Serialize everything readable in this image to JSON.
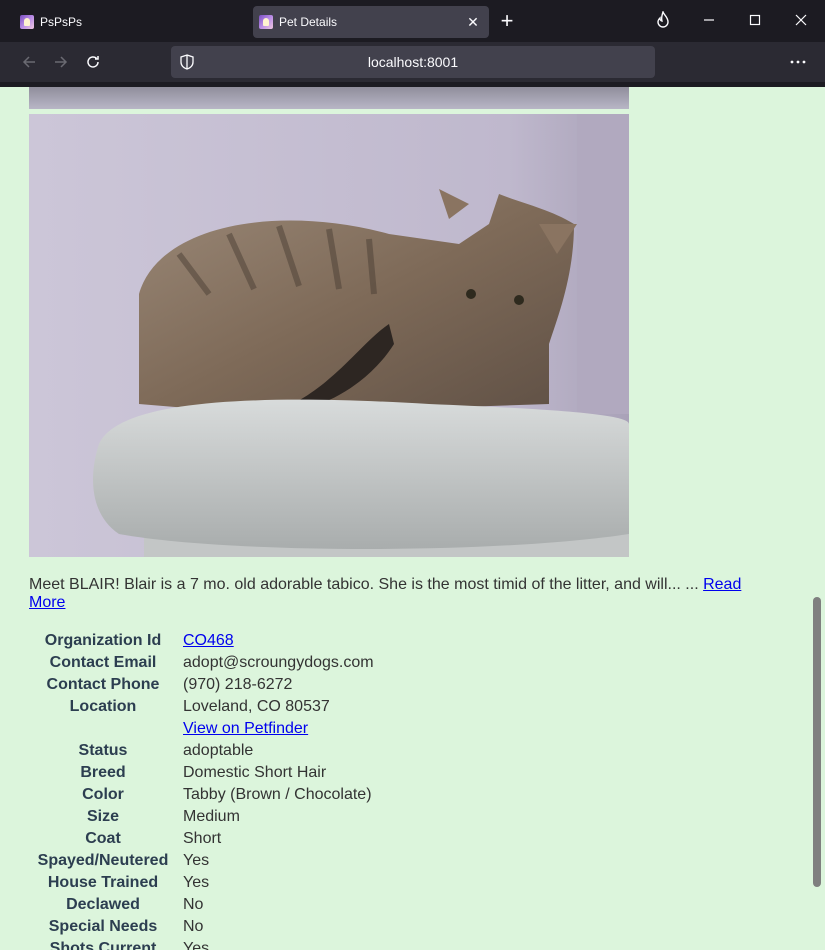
{
  "browser": {
    "tabs": [
      {
        "title": "PsPsPs",
        "active": false
      },
      {
        "title": "Pet Details",
        "active": true
      }
    ],
    "url": "localhost:8001"
  },
  "page": {
    "description": "Meet BLAIR!  Blair is a 7 mo. old adorable tabico.  She is the most timid of the litter, and will... ...",
    "read_more_label": "Read More",
    "details": [
      {
        "label": "Organization Id",
        "value": "CO468",
        "is_link": true
      },
      {
        "label": "Contact Email",
        "value": "adopt@scroungydogs.com",
        "is_link": false
      },
      {
        "label": "Contact Phone",
        "value": "(970) 218-6272",
        "is_link": false
      },
      {
        "label": "Location",
        "value": "Loveland, CO 80537",
        "is_link": false
      },
      {
        "label": "",
        "value": "View on Petfinder",
        "is_link": true
      },
      {
        "label": "Status",
        "value": "adoptable",
        "is_link": false
      },
      {
        "label": "Breed",
        "value": "Domestic Short Hair",
        "is_link": false
      },
      {
        "label": "Color",
        "value": "Tabby (Brown / Chocolate)",
        "is_link": false
      },
      {
        "label": "Size",
        "value": "Medium",
        "is_link": false
      },
      {
        "label": "Coat",
        "value": "Short",
        "is_link": false
      },
      {
        "label": "Spayed/Neutered",
        "value": "Yes",
        "is_link": false
      },
      {
        "label": "House Trained",
        "value": "Yes",
        "is_link": false
      },
      {
        "label": "Declawed",
        "value": "No",
        "is_link": false
      },
      {
        "label": "Special Needs",
        "value": "No",
        "is_link": false
      },
      {
        "label": "Shots Current",
        "value": "Yes",
        "is_link": false
      }
    ]
  }
}
